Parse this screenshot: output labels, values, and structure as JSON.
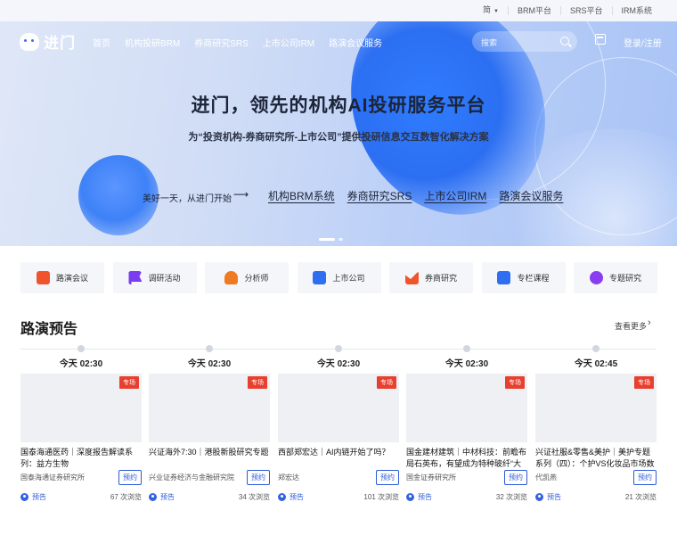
{
  "topbar": {
    "lang": "简",
    "items": [
      "BRM平台",
      "SRS平台",
      "IRM系统"
    ]
  },
  "logo": "进门",
  "nav": {
    "items": [
      "首页",
      "机构投研BRM",
      "券商研究SRS",
      "上市公司IRM",
      "路演会议服务"
    ],
    "search_placeholder": "搜索",
    "login": "登录/注册"
  },
  "hero": {
    "title": "进门，领先的机构AI投研服务平台",
    "subtitle": "为“投资机构-券商研究所-上市公司”提供投研信息交互数智化解决方案",
    "cta": "美好一天，从进门开始",
    "arrow": "⟶",
    "links": [
      "机构BRM系统",
      "券商研究SRS",
      "上市公司IRM",
      "路演会议服务"
    ]
  },
  "categories": [
    {
      "label": "路演会议",
      "color": "#f0542d",
      "icon": "meeting-icon"
    },
    {
      "label": "调研活动",
      "color": "#7a3df0",
      "icon": "flag-icon"
    },
    {
      "label": "分析师",
      "color": "#f07a22",
      "icon": "analyst-icon"
    },
    {
      "label": "上市公司",
      "color": "#2f6ef0",
      "icon": "company-icon"
    },
    {
      "label": "券商研究",
      "color": "#f0542d",
      "icon": "research-icon"
    },
    {
      "label": "专栏课程",
      "color": "#2f6ef0",
      "icon": "book-icon"
    },
    {
      "label": "专题研究",
      "color": "#8a3df0",
      "icon": "topic-icon"
    }
  ],
  "section": {
    "title": "路演预告",
    "more": "查看更多",
    "more_arrow": "›"
  },
  "cards": [
    {
      "time": "今天 02:30",
      "tag": "专场",
      "title": "国泰海通医药｜深度报告解读系列：益方生物",
      "org": "国泰海通证券研究所",
      "book": "预约",
      "preview": "预告",
      "views": "67 次浏览"
    },
    {
      "time": "今天 02:30",
      "tag": "专场",
      "title": "兴证海外7:30｜港股新股研究专题",
      "org": "兴业证券经济与金融研究院",
      "book": "预约",
      "preview": "预告",
      "views": "34 次浏览"
    },
    {
      "time": "今天 02:30",
      "tag": "专场",
      "title": "西部郑宏达｜AI内链开始了吗？",
      "org": "郑宏达",
      "book": "预约",
      "preview": "预告",
      "views": "101 次浏览"
    },
    {
      "time": "今天 02:30",
      "tag": "专场",
      "title": "国金建材建筑｜中材科技：前瞻布局石英布，有望成为特种玻纤“大满贯”",
      "org": "国金证券研究所",
      "book": "预约",
      "preview": "预告",
      "views": "32 次浏览"
    },
    {
      "time": "今天 02:45",
      "tag": "专场",
      "title": "兴证社服&零售&美护｜美护专题系列（四）：个护VS化妆品市场数据…",
      "org": "代凯燕",
      "book": "预约",
      "preview": "预告",
      "views": "21 次浏览"
    }
  ]
}
